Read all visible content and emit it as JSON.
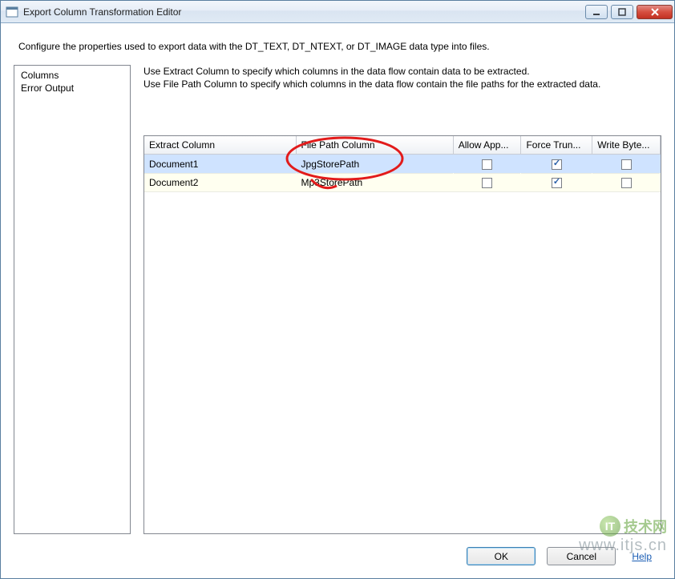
{
  "window": {
    "title": "Export Column Transformation Editor"
  },
  "description": "Configure the properties used to export data with the DT_TEXT, DT_NTEXT, or DT_IMAGE data type into files.",
  "sidebar": {
    "items": [
      {
        "label": "Columns"
      },
      {
        "label": "Error Output"
      }
    ]
  },
  "instructions": {
    "line1": "Use Extract Column to specify which columns in the data flow contain data to be extracted.",
    "line2": "Use File Path Column to specify which columns in the data flow contain the file paths for the extracted data."
  },
  "grid": {
    "headers": {
      "extract": "Extract Column",
      "filepath": "File Path Column",
      "allow": "Allow App...",
      "force": "Force Trun...",
      "write": "Write Byte..."
    },
    "rows": [
      {
        "extract": "Document1",
        "filepath": "JpgStorePath",
        "allow": false,
        "force": true,
        "write": false,
        "selected": true
      },
      {
        "extract": "Document2",
        "filepath": "Mp3StorePath",
        "allow": false,
        "force": true,
        "write": false,
        "selected": false
      }
    ]
  },
  "buttons": {
    "ok": "OK",
    "cancel": "Cancel",
    "help": "Help"
  },
  "watermark": {
    "line1": "技术网",
    "line2": "www.itjs.cn",
    "badge": "IT"
  }
}
